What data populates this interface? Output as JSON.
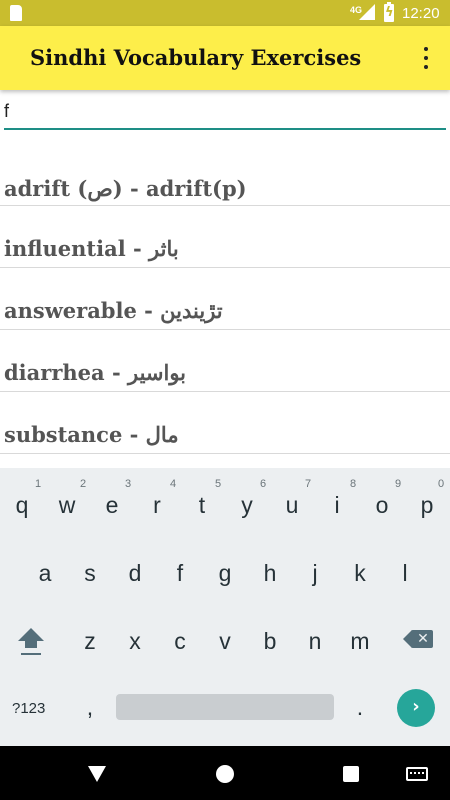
{
  "status_bar": {
    "network": "4G",
    "time": "12:20",
    "icons": [
      "sd-card-icon",
      "signal-icon",
      "battery-charging-icon"
    ]
  },
  "app_bar": {
    "title": "Sindhi Vocabulary Exercises",
    "overflow_icon": "overflow-menu-icon"
  },
  "search": {
    "value": "f",
    "placeholder": ""
  },
  "results": [
    {
      "label": "adrift (ص) - adrift(p)"
    },
    {
      "label": "influential - باثر"
    },
    {
      "label": "answerable - تڙيندين"
    },
    {
      "label": "diarrhea - بواسير"
    },
    {
      "label": "substance - مال"
    }
  ],
  "keyboard": {
    "row1": [
      "q",
      "w",
      "e",
      "r",
      "t",
      "y",
      "u",
      "i",
      "o",
      "p"
    ],
    "row1_hints": [
      "1",
      "2",
      "3",
      "4",
      "5",
      "6",
      "7",
      "8",
      "9",
      "0"
    ],
    "row2": [
      "a",
      "s",
      "d",
      "f",
      "g",
      "h",
      "j",
      "k",
      "l"
    ],
    "row3": [
      "z",
      "x",
      "c",
      "v",
      "b",
      "n",
      "m"
    ],
    "symbols_label": "?123",
    "comma": ",",
    "period": ".",
    "enter_glyph": "›",
    "backspace_glyph": "✕"
  },
  "nav_bar": {
    "icons": [
      "back-icon",
      "home-icon",
      "recents-icon",
      "keyboard-icon"
    ]
  },
  "colors": {
    "status_bar": "#c9bd2e",
    "app_bar": "#fdee4a",
    "accent": "#1e8e86",
    "enter_key": "#26a69a"
  }
}
